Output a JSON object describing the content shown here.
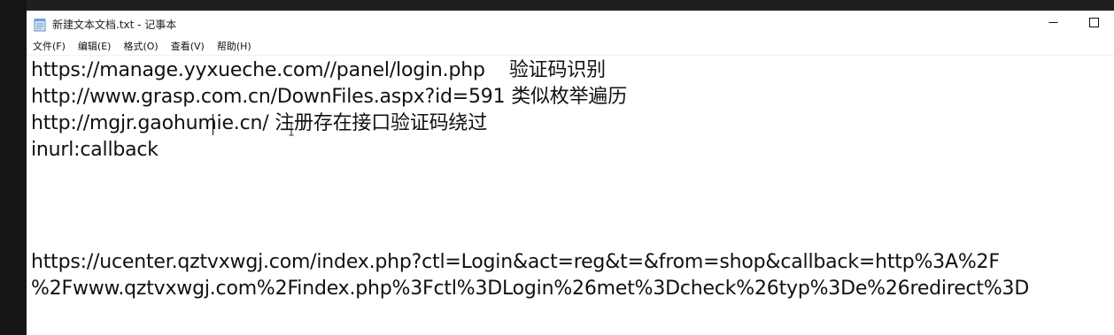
{
  "window": {
    "title": "新建文本文档.txt - 记事本",
    "controls": {
      "minimize": "—",
      "maximize": "☐"
    }
  },
  "menu": {
    "items": [
      "文件(F)",
      "编辑(E)",
      "格式(O)",
      "查看(V)",
      "帮助(H)"
    ]
  },
  "editor": {
    "lines": [
      "https://manage.yyxueche.com//panel/login.php    验证码识别",
      "http://www.grasp.com.cn/DownFiles.aspx?id=591 类似枚举遍历",
      "http://mgjr.gaohumie.cn/ 注册存在接口验证码绕过",
      "inurl:callback",
      "",
      "",
      "",
      "https://ucenter.qztvxwgj.com/index.php?ctl=Login&act=reg&t=&from=shop&callback=http%3A%2F",
      "%2Fwww.qztvxwgj.com%2Findex.php%3Fctl%3DLogin%26met%3Dcheck%26typ%3De%26redirect%3D"
    ]
  },
  "icons": {
    "app": "notepad-icon",
    "minimize": "minimize-icon",
    "maximize": "maximize-icon",
    "caret": "text-caret",
    "mouse": "ibeam-cursor-icon"
  }
}
